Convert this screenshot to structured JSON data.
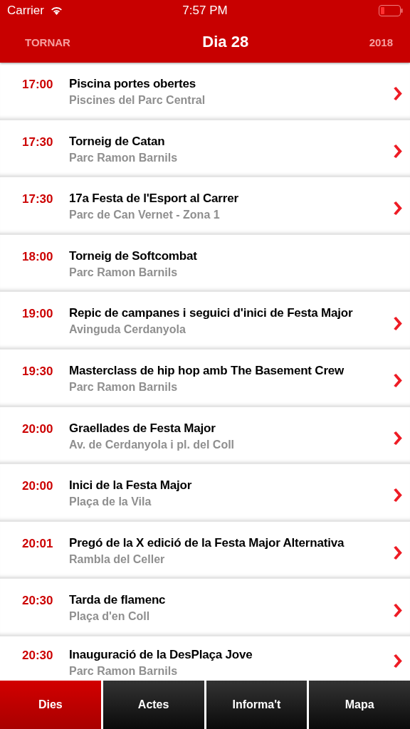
{
  "status_bar": {
    "carrier": "Carrier",
    "time": "7:57 PM"
  },
  "nav": {
    "back": "TORNAR",
    "title": "Dia 28",
    "year": "2018"
  },
  "events": [
    {
      "time": "17:00",
      "title": "Piscina portes obertes",
      "place": "Piscines del Parc Central",
      "has_detail": true
    },
    {
      "time": "17:30",
      "title": "Torneig de Catan",
      "place": "Parc Ramon Barnils",
      "has_detail": true
    },
    {
      "time": "17:30",
      "title": "17a Festa de l'Esport al Carrer",
      "place": "Parc de Can Vernet - Zona 1",
      "has_detail": true
    },
    {
      "time": "18:00",
      "title": "Torneig de Softcombat",
      "place": "Parc Ramon Barnils",
      "has_detail": false
    },
    {
      "time": "19:00",
      "title": "Repic de campanes i seguici d'inici de Festa Major",
      "place": "Avinguda Cerdanyola",
      "has_detail": true
    },
    {
      "time": "19:30",
      "title": "Masterclass de hip hop amb The Basement Crew",
      "place": "Parc Ramon Barnils",
      "has_detail": true
    },
    {
      "time": "20:00",
      "title": "Graellades de Festa Major",
      "place": "Av. de Cerdanyola i pl. del Coll",
      "has_detail": true
    },
    {
      "time": "20:00",
      "title": "Inici de la Festa Major",
      "place": "Plaça de la Vila",
      "has_detail": true
    },
    {
      "time": "20:01",
      "title": "Pregó de la X edició de la Festa Major Alternativa",
      "place": "Rambla del Celler",
      "has_detail": true
    },
    {
      "time": "20:30",
      "title": "Tarda de flamenc",
      "place": "Plaça d'en Coll",
      "has_detail": true
    },
    {
      "time": "20:30",
      "title": "Inauguració de la DesPlaça Jove",
      "place": "Parc Ramon Barnils",
      "has_detail": true
    }
  ],
  "tabs": [
    {
      "label": "Dies",
      "selected": true
    },
    {
      "label": "Actes",
      "selected": false
    },
    {
      "label": "Informa't",
      "selected": false
    },
    {
      "label": "Mapa",
      "selected": false
    }
  ]
}
